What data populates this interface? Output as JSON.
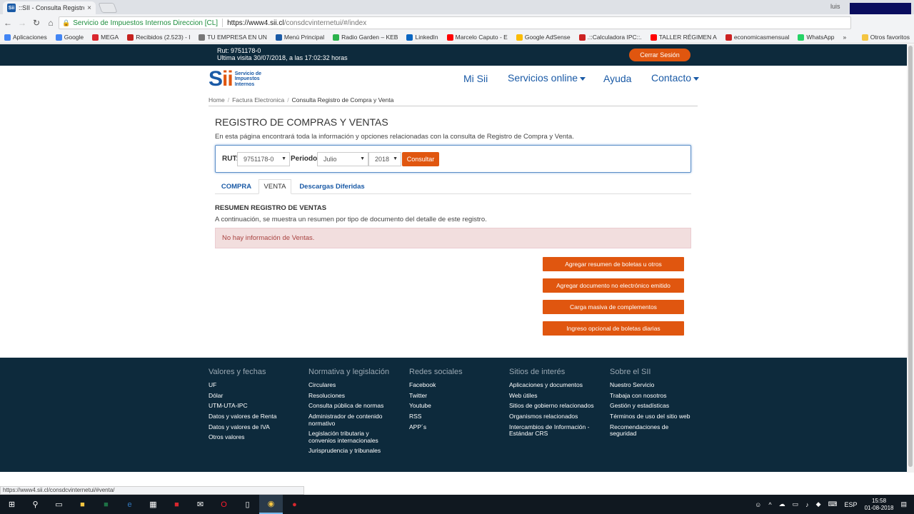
{
  "browser": {
    "tab_title": "::SII - Consulta Registro C",
    "tab_close": "×",
    "user_label": "luis",
    "secure_label": "Servicio de Impuestos Internos Direccion [CL]",
    "url_host": "https://www4.sii.cl",
    "url_path": "/consdcvinternetui/#/index",
    "bookmarks": [
      {
        "label": "Aplicaciones",
        "icon": "apps-grid-icon",
        "color": "#4285f4"
      },
      {
        "label": "Google",
        "icon": "google-icon",
        "color": "#4285f4"
      },
      {
        "label": "MEGA",
        "icon": "mega-icon",
        "color": "#d9272e"
      },
      {
        "label": "Recibidos (2.523) - l",
        "icon": "gmail-icon",
        "color": "#c5221f"
      },
      {
        "label": "TU EMPRESA EN UN",
        "icon": "page-icon",
        "color": "#777777"
      },
      {
        "label": "Menú Principal",
        "icon": "sii-icon",
        "color": "#1a5aa6"
      },
      {
        "label": "Radio Garden – KEB",
        "icon": "radio-garden-icon",
        "color": "#2bb24c"
      },
      {
        "label": "LinkedIn",
        "icon": "linkedin-icon",
        "color": "#0a66c2"
      },
      {
        "label": "Marcelo Caputo - E",
        "icon": "youtube-icon",
        "color": "#ff0000"
      },
      {
        "label": "Google AdSense",
        "icon": "adsense-icon",
        "color": "#fbbc04"
      },
      {
        "label": ".::Calculadora IPC::.",
        "icon": "ine-icon",
        "color": "#cc2222"
      },
      {
        "label": "TALLER RÉGIMEN A",
        "icon": "youtube-icon",
        "color": "#ff0000"
      },
      {
        "label": "economicasmensual",
        "icon": "ine-icon",
        "color": "#cc2222"
      },
      {
        "label": "WhatsApp",
        "icon": "whatsapp-icon",
        "color": "#25d366"
      },
      {
        "label": "»",
        "icon": "",
        "color": ""
      },
      {
        "label": "Otros favoritos",
        "icon": "folder-icon",
        "color": "#f4c542"
      }
    ],
    "status_url": "https://www4.sii.cl/consdcvinternetui/#venta/"
  },
  "session": {
    "rut_line": "Rut: 9751178-0",
    "last_visit": "Ultima visita 30/07/2018, a las 17:02:32 horas",
    "logout_label": "Cerrar Sesión"
  },
  "brand": {
    "mark_main": "S",
    "mark_accent": "ii",
    "line1": "Servicio de",
    "line2": "Impuestos",
    "line3": "Internos"
  },
  "nav": {
    "mi_sii": "Mi Sii",
    "servicios": "Servicios online",
    "ayuda": "Ayuda",
    "contacto": "Contacto"
  },
  "breadcrumb": {
    "home": "Home",
    "factura": "Factura Electronica",
    "current": "Consulta Registro de Compra y Venta",
    "sep": "/"
  },
  "page": {
    "title": "REGISTRO DE COMPRAS Y VENTAS",
    "description": "En esta página encontrará toda la información y opciones relacionadas con la consulta de Registro de Compra y Venta."
  },
  "filters": {
    "rut_label": "RUT:",
    "rut_value": "9751178-0",
    "periodo_label": "Periodo:",
    "month_value": "Julio",
    "year_value": "2018",
    "submit_label": "Consultar",
    "arrow": "▼"
  },
  "tabs": {
    "compra": "COMPRA",
    "venta": "VENTA",
    "descargas": "Descargas Diferidas"
  },
  "venta": {
    "section_title": "RESUMEN REGISTRO DE VENTAS",
    "section_desc": "A continuación, se muestra un resumen por tipo de documento del detalle de este registro.",
    "empty_alert": "No hay información de Ventas.",
    "actions": [
      "Agregar resumen de boletas u otros",
      "Agregar documento no electrónico emitido",
      "Carga masiva de complementos",
      "Ingreso opcional de boletas diarias"
    ]
  },
  "footer": {
    "columns": [
      {
        "heading": "Valores y fechas",
        "links": [
          "UF",
          "Dólar",
          "UTM-UTA-IPC",
          "Datos y valores de Renta",
          "Datos y valores de IVA",
          "Otros valores"
        ]
      },
      {
        "heading": "Normativa y legislación",
        "links": [
          "Circulares",
          "Resoluciones",
          "Consulta pública de normas",
          "Administrador de contenido normativo",
          "Legislación tributaria y convenios internacionales",
          "Jurisprudencia y tribunales"
        ]
      },
      {
        "heading": "Redes sociales",
        "links": [
          "Facebook",
          "Twitter",
          "Youtube",
          "RSS",
          "APP´s"
        ]
      },
      {
        "heading": "Sitios de interés",
        "links": [
          "Aplicaciones y documentos",
          "Web útiles",
          "Sitios de gobierno relacionados",
          "Organismos relacionados",
          "Intercambios de Información - Estándar CRS"
        ]
      },
      {
        "heading": "Sobre el SII",
        "links": [
          "Nuestro Servicio",
          "Trabaja con nosotros",
          "Gestión y estadísticas",
          "Términos de uso del sitio web",
          "Recomendaciones de seguridad"
        ]
      }
    ]
  },
  "taskbar": {
    "language": "ESP",
    "time": "15:58",
    "date": "01-08-2018"
  },
  "colors": {
    "accent_orange": "#e0560f",
    "sii_blue": "#1a5aa6",
    "dark_navy": "#0d2a3c"
  }
}
